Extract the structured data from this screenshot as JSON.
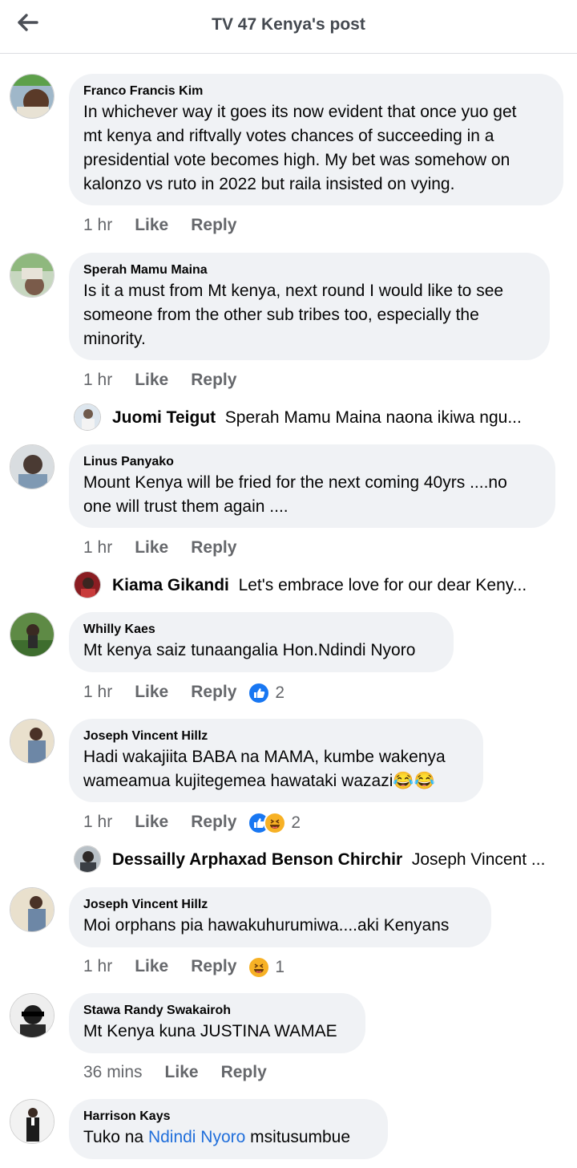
{
  "header": {
    "title": "TV 47 Kenya's post"
  },
  "actions": {
    "like": "Like",
    "reply": "Reply"
  },
  "comments": [
    {
      "author": "Franco Francis Kim",
      "lines": [
        "In whichever way it goes its now evident that once yuo get",
        "mt kenya and riftvally votes chances of succeeding in a",
        "presidential vote becomes high. My bet was somehow on",
        "kalonzo vs ruto in 2022 but raila insisted on vying."
      ],
      "time": "1 hr"
    },
    {
      "author": "Sperah Mamu Maina",
      "lines": [
        "Is it a must from Mt kenya, next round I would like to see",
        "someone from the other sub tribes too, especially the",
        "minority."
      ],
      "time": "1 hr",
      "reply": {
        "name": "Juomi Teigut",
        "preview": "Sperah Mamu Maina naona ikiwa ngu..."
      }
    },
    {
      "author": "Linus Panyako",
      "lines": [
        "Mount Kenya will be fried for the next coming 40yrs ....no",
        "one will trust them again ...."
      ],
      "time": "1 hr",
      "reply": {
        "name": "Kiama Gikandi",
        "preview": "Let's embrace love for our dear Keny..."
      }
    },
    {
      "author": "Whilly Kaes",
      "lines": [
        "Mt kenya saiz tunaangalia Hon.Ndindi Nyoro"
      ],
      "time": "1 hr",
      "reactions": [
        "like"
      ],
      "reaction_count": "2"
    },
    {
      "author": "Joseph Vincent Hillz",
      "lines": [
        "Hadi wakajiita BABA na MAMA, kumbe wakenya",
        "wameamua kujitegemea hawataki wazazi😂😂"
      ],
      "time": "1 hr",
      "reactions": [
        "like",
        "haha"
      ],
      "reaction_count": "2",
      "reply": {
        "name": "Dessailly Arphaxad Benson Chirchir",
        "preview": "Joseph Vincent ..."
      }
    },
    {
      "author": "Joseph Vincent Hillz",
      "lines": [
        "Moi orphans pia hawakuhurumiwa....aki Kenyans"
      ],
      "time": "1 hr",
      "reactions": [
        "haha"
      ],
      "reaction_count": "1"
    },
    {
      "author": "Stawa Randy Swakairoh",
      "lines": [
        "Mt Kenya kuna JUSTINA WAMAE"
      ],
      "time": "36 mins"
    },
    {
      "author": "Harrison Kays",
      "text_before": "Tuko na ",
      "mention": "Ndindi Nyoro",
      "text_after": " msitusumbue"
    }
  ],
  "colors": {
    "bubble": "#f0f2f5",
    "muted": "#65676b",
    "mention": "#216fdb",
    "like_blue": "#1877f2",
    "haha_yellow": "#f7b125"
  }
}
